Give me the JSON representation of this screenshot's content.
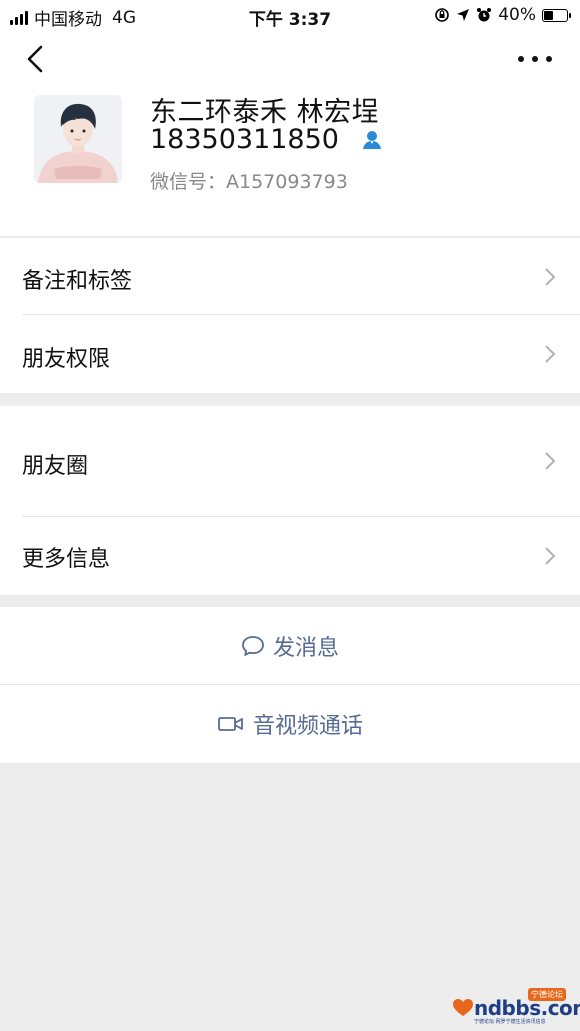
{
  "status_bar": {
    "carrier": "中国移动",
    "network": "4G",
    "time": "下午 3:37",
    "battery": "40%",
    "battery_level": 0.4
  },
  "profile": {
    "name": "东二环泰禾 林宏埕",
    "phone": "18350311850",
    "wechat_id": "微信号：A157093793"
  },
  "menu": {
    "remark_tags": "备注和标签",
    "friend_permissions": "朋友权限",
    "moments": "朋友圈",
    "more_info": "更多信息"
  },
  "actions": {
    "send_message": "发消息",
    "video_call": "音视频通话"
  },
  "watermark": {
    "site": "ndbbs.com",
    "badge": "宁德论坛",
    "tagline": "宁德论坛·网罗宁德生活资讯信息"
  },
  "colors": {
    "link_blue": "#576b95",
    "contact_icon": "#2a8bd5",
    "background": "#ededed"
  },
  "icons": {
    "back": "chevron-left-icon",
    "more": "more-dots-icon",
    "contact": "contact-person-icon",
    "chevron": "chevron-right-icon",
    "message": "speech-bubble-icon",
    "video": "video-camera-icon"
  }
}
